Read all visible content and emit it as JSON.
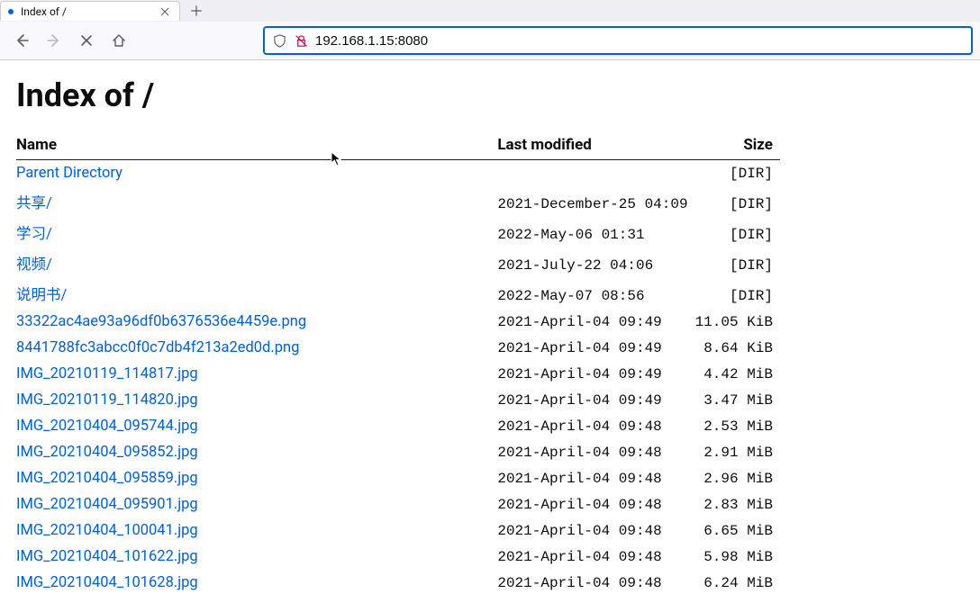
{
  "browser": {
    "tab_title": "Index of /",
    "url": "192.168.1.15:8080"
  },
  "page": {
    "heading": "Index of /",
    "columns": {
      "name": "Name",
      "modified": "Last modified",
      "size": "Size"
    },
    "entries": [
      {
        "name": "Parent Directory",
        "modified": "",
        "size": "[DIR]"
      },
      {
        "name": "共享/",
        "modified": "2021-December-25 04:09",
        "size": "[DIR]"
      },
      {
        "name": "学习/",
        "modified": "2022-May-06 01:31",
        "size": "[DIR]"
      },
      {
        "name": "视频/",
        "modified": "2021-July-22 04:06",
        "size": "[DIR]"
      },
      {
        "name": "说明书/",
        "modified": "2022-May-07 08:56",
        "size": "[DIR]"
      },
      {
        "name": "33322ac4ae93a96df0b6376536e4459e.png",
        "modified": "2021-April-04 09:49",
        "size": "11.05 KiB"
      },
      {
        "name": "8441788fc3abcc0f0c7db4f213a2ed0d.png",
        "modified": "2021-April-04 09:49",
        "size": "8.64 KiB"
      },
      {
        "name": "IMG_20210119_114817.jpg",
        "modified": "2021-April-04 09:49",
        "size": "4.42 MiB"
      },
      {
        "name": "IMG_20210119_114820.jpg",
        "modified": "2021-April-04 09:49",
        "size": "3.47 MiB"
      },
      {
        "name": "IMG_20210404_095744.jpg",
        "modified": "2021-April-04 09:48",
        "size": "2.53 MiB"
      },
      {
        "name": "IMG_20210404_095852.jpg",
        "modified": "2021-April-04 09:48",
        "size": "2.91 MiB"
      },
      {
        "name": "IMG_20210404_095859.jpg",
        "modified": "2021-April-04 09:48",
        "size": "2.96 MiB"
      },
      {
        "name": "IMG_20210404_095901.jpg",
        "modified": "2021-April-04 09:48",
        "size": "2.83 MiB"
      },
      {
        "name": "IMG_20210404_100041.jpg",
        "modified": "2021-April-04 09:48",
        "size": "6.65 MiB"
      },
      {
        "name": "IMG_20210404_101622.jpg",
        "modified": "2021-April-04 09:48",
        "size": "5.98 MiB"
      },
      {
        "name": "IMG_20210404_101628.jpg",
        "modified": "2021-April-04 09:48",
        "size": "6.24 MiB"
      }
    ]
  }
}
